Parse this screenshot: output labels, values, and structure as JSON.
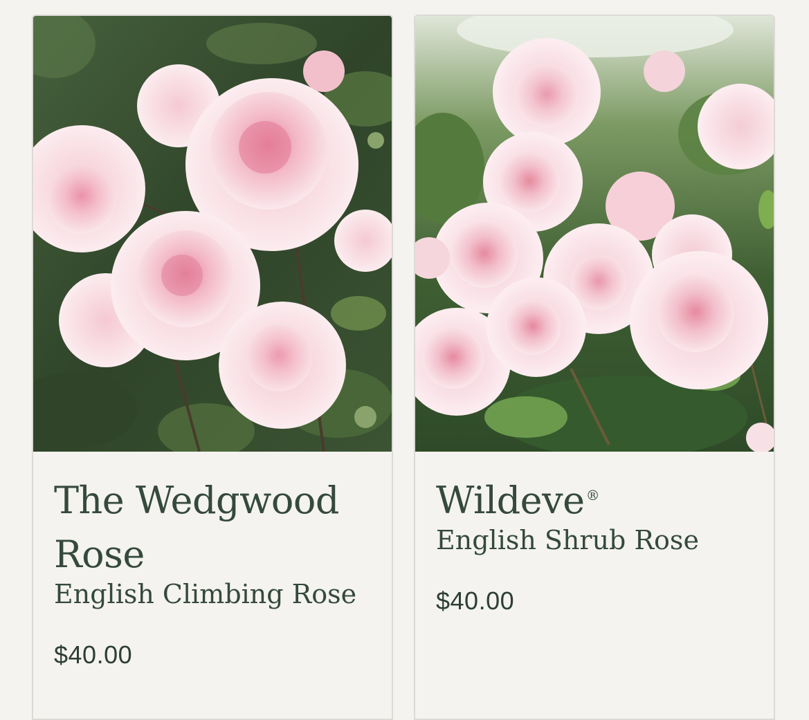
{
  "products": [
    {
      "name": "The Wedgwood Rose",
      "registered": "",
      "type": "English Climbing Rose",
      "price": "$40.00"
    },
    {
      "name": "Wildeve",
      "registered": "®",
      "type": "English Shrub Rose",
      "price": "$40.00"
    }
  ],
  "colors": {
    "background": "#f4f3ef",
    "text": "#35493d",
    "card_border": "#dcdad5",
    "rose_pink": "#f2c3cf",
    "foliage": "#3d5a34"
  }
}
